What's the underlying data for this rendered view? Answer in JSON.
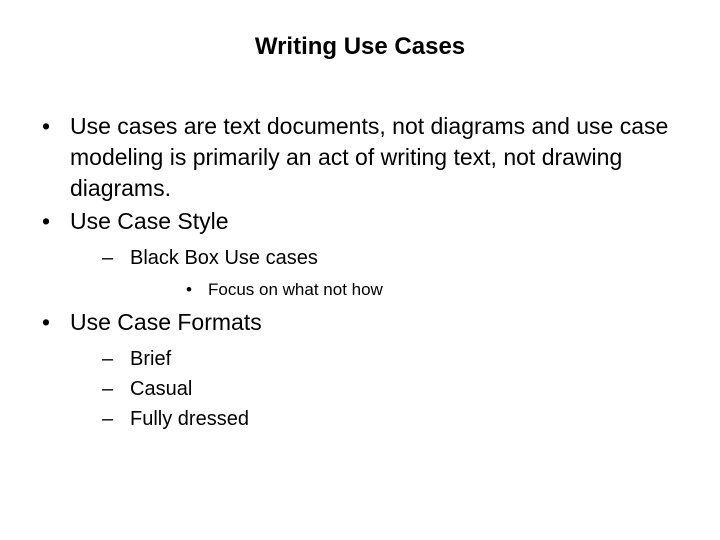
{
  "title": "Writing Use Cases",
  "bullets": {
    "b1": "Use cases are text documents, not diagrams and use case modeling is primarily an act of writing text, not drawing diagrams.",
    "b2": "Use Case Style",
    "b2_1": "Black Box Use cases",
    "b2_1_1": "Focus on what not how",
    "b3": "Use Case Formats",
    "b3_1": "Brief",
    "b3_2": "Casual",
    "b3_3": "Fully dressed"
  }
}
